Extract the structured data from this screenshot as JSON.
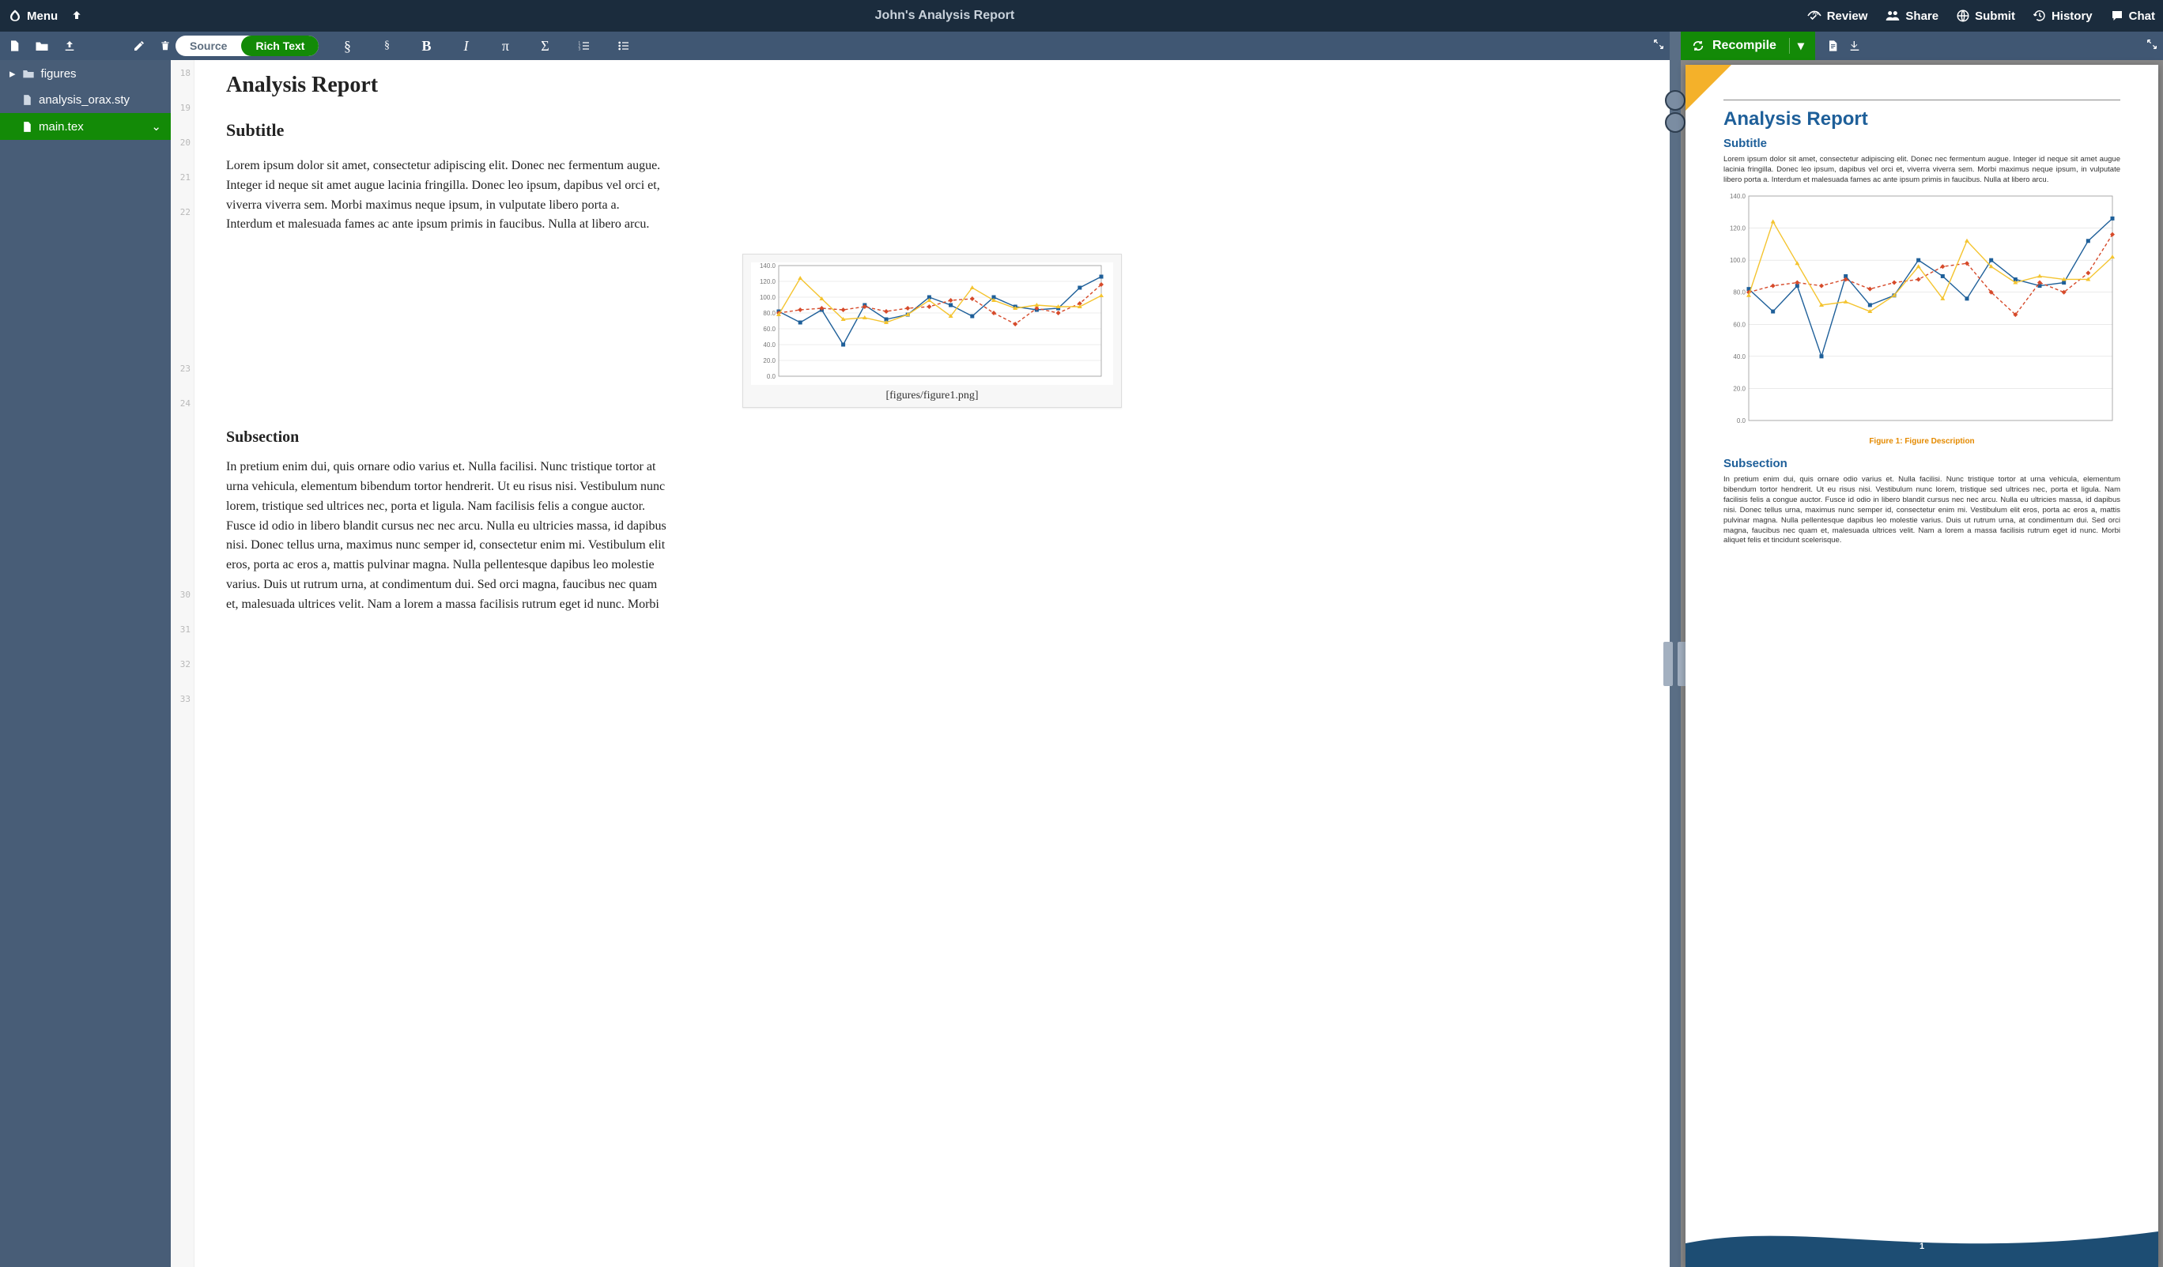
{
  "header": {
    "menu_label": "Menu",
    "project_title": "John's Analysis Report",
    "actions": {
      "review": "Review",
      "share": "Share",
      "submit": "Submit",
      "history": "History",
      "chat": "Chat"
    }
  },
  "editor_toolbar": {
    "source_label": "Source",
    "richtext_label": "Rich Text",
    "recompile_label": "Recompile"
  },
  "file_tree": {
    "folder": "figures",
    "files": [
      "analysis_orax.sty",
      "main.tex"
    ],
    "active": "main.tex"
  },
  "gutter_lines": [
    "18",
    "",
    "19",
    "",
    "20",
    "",
    "21",
    "",
    "22",
    "",
    "",
    "",
    "",
    "",
    "",
    "",
    "",
    "23",
    "",
    "24",
    "",
    "",
    "",
    "",
    "",
    "",
    "",
    "",
    "",
    "",
    "30",
    "",
    "31",
    "",
    "32",
    "",
    "33"
  ],
  "document": {
    "title": "Analysis Report",
    "subtitle": "Subtitle",
    "para1": "Lorem ipsum dolor sit amet, consectetur adipiscing elit. Donec nec fermentum augue. Integer id neque sit amet augue lacinia fringilla. Donec leo ipsum, dapibus vel orci et, viverra viverra sem. Morbi maximus neque ipsum, in vulputate libero porta a. Interdum et malesuada fames ac ante ipsum primis in faucibus. Nulla at libero arcu.",
    "figure_path": "[figures/figure1.png]",
    "subsection_heading": "Subsection",
    "para2": "In pretium enim dui, quis ornare odio varius et. Nulla facilisi. Nunc tristique tortor at urna vehicula, elementum bibendum tortor hendrerit. Ut eu risus nisi. Vestibulum nunc lorem, tristique sed ultrices nec, porta et ligula. Nam facilisis felis a congue auctor. Fusce id odio in libero blandit cursus nec nec arcu. Nulla eu ultricies massa, id dapibus nisi. Donec tellus urna, maximus nunc semper id, consectetur enim mi. Vestibulum elit eros, porta ac eros a, mattis pulvinar magna. Nulla pellentesque dapibus leo molestie varius. Duis ut rutrum urna, at condimentum dui. Sed orci magna, faucibus nec quam et, malesuada ultrices velit. Nam a lorem a massa facilisis rutrum eget id nunc. Morbi"
  },
  "pdf": {
    "title": "Analysis Report",
    "subtitle": "Subtitle",
    "para1": "Lorem ipsum dolor sit amet, consectetur adipiscing elit. Donec nec fermentum augue. Integer id neque sit amet augue lacinia fringilla. Donec leo ipsum, dapibus vel orci et, viverra viverra sem. Morbi maximus neque ipsum, in vulputate libero porta a. Interdum et malesuada fames ac ante ipsum primis in faucibus. Nulla at libero arcu.",
    "figure_caption": "Figure 1: Figure Description",
    "subsection_heading": "Subsection",
    "para2": "In pretium enim dui, quis ornare odio varius et. Nulla facilisi. Nunc tristique tortor at urna vehicula, elementum bibendum tortor hendrerit. Ut eu risus nisi. Vestibulum nunc lorem, tristique sed ultrices nec, porta et ligula. Nam facilisis felis a congue auctor. Fusce id odio in libero blandit cursus nec nec arcu. Nulla eu ultricies massa, id dapibus nisi. Donec tellus urna, maximus nunc semper id, consectetur enim mi. Vestibulum elit eros, porta ac eros a, mattis pulvinar magna. Nulla pellentesque dapibus leo molestie varius. Duis ut rutrum urna, at condimentum dui. Sed orci magna, faucibus nec quam et, malesuada ultrices velit. Nam a lorem a massa facilisis rutrum eget id nunc. Morbi aliquet felis et tincidunt scelerisque.",
    "page_number": "1"
  },
  "chart_data": {
    "type": "line",
    "title": "",
    "xlabel": "",
    "ylabel": "",
    "ylim": [
      0,
      140
    ],
    "yticks": [
      0,
      20,
      40,
      60,
      80,
      100,
      120,
      140
    ],
    "x": [
      1,
      2,
      3,
      4,
      5,
      6,
      7,
      8,
      9,
      10,
      11,
      12,
      13,
      14,
      15,
      16
    ],
    "series": [
      {
        "name": "blue",
        "color": "#1e5f99",
        "style": "solid",
        "marker": "square",
        "values": [
          82,
          68,
          84,
          40,
          90,
          72,
          78,
          100,
          90,
          76,
          100,
          88,
          84,
          86,
          112,
          126
        ]
      },
      {
        "name": "red",
        "color": "#d64a2a",
        "style": "dashed",
        "marker": "diamond",
        "values": [
          80,
          84,
          86,
          84,
          88,
          82,
          86,
          88,
          96,
          98,
          80,
          66,
          86,
          80,
          92,
          116
        ]
      },
      {
        "name": "yellow",
        "color": "#f4c430",
        "style": "solid",
        "marker": "triangle",
        "values": [
          78,
          124,
          98,
          72,
          74,
          68,
          78,
          96,
          76,
          112,
          96,
          86,
          90,
          88,
          88,
          102
        ]
      }
    ]
  }
}
